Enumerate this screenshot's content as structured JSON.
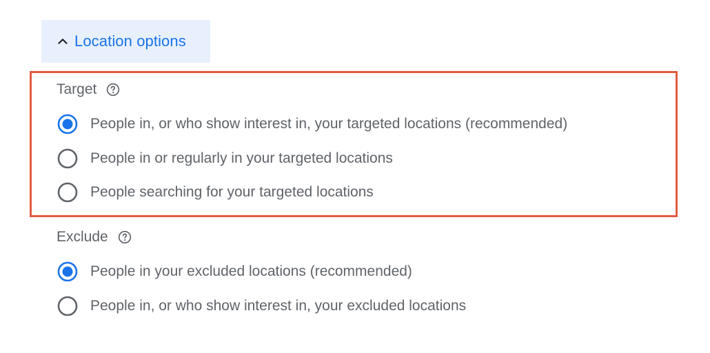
{
  "location_options": {
    "toggle_label": "Location options",
    "expanded": true
  },
  "target": {
    "title": "Target",
    "options": [
      {
        "label": "People in, or who show interest in, your targeted locations (recommended)",
        "selected": true
      },
      {
        "label": "People in or regularly in your targeted locations",
        "selected": false
      },
      {
        "label": "People searching for your targeted locations",
        "selected": false
      }
    ]
  },
  "exclude": {
    "title": "Exclude",
    "options": [
      {
        "label": "People in your excluded locations (recommended)",
        "selected": true
      },
      {
        "label": "People in, or who show interest in, your excluded locations",
        "selected": false
      }
    ]
  },
  "colors": {
    "accent": "#1a73e8",
    "toggle_bg": "#e8f0fe",
    "highlight_border": "#e25a43",
    "text": "#5f6368",
    "radio_unselected": "#5f6368"
  },
  "icons": {
    "toggle": "chevron-up-icon",
    "help": "help-circle-icon"
  }
}
